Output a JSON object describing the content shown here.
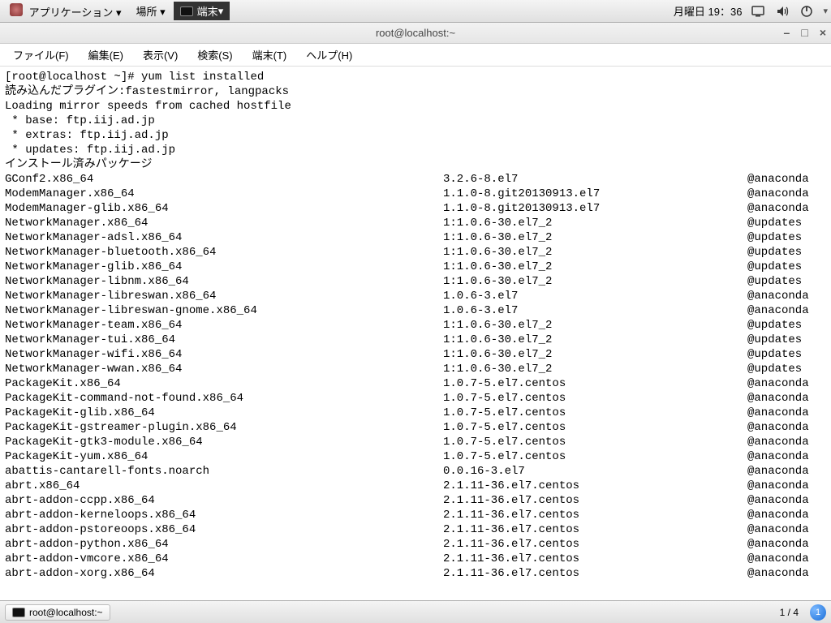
{
  "top_panel": {
    "apps": "アプリケーション",
    "places": "場所",
    "active": "端末",
    "date": "月曜日 19：36"
  },
  "window": {
    "title": "root@localhost:~",
    "menu": {
      "file": "ファイル(F)",
      "edit": "編集(E)",
      "view": "表示(V)",
      "search": "検索(S)",
      "terminal": "端末(T)",
      "help": "ヘルプ(H)"
    }
  },
  "term": {
    "prompt": "[root@localhost ~]# yum list installed",
    "plugin": "読み込んだプラグイン:fastestmirror, langpacks",
    "loading": "Loading mirror speeds from cached hostfile",
    "m_base": " * base: ftp.iij.ad.jp",
    "m_extras": " * extras: ftp.iij.ad.jp",
    "m_updates": " * updates: ftp.iij.ad.jp",
    "installed_header": "インストール済みパッケージ"
  },
  "packages": [
    {
      "name": "GConf2.x86_64",
      "ver": "3.2.6-8.el7",
      "repo": "@anaconda"
    },
    {
      "name": "ModemManager.x86_64",
      "ver": "1.1.0-8.git20130913.el7",
      "repo": "@anaconda"
    },
    {
      "name": "ModemManager-glib.x86_64",
      "ver": "1.1.0-8.git20130913.el7",
      "repo": "@anaconda"
    },
    {
      "name": "NetworkManager.x86_64",
      "ver": "1:1.0.6-30.el7_2",
      "repo": "@updates"
    },
    {
      "name": "NetworkManager-adsl.x86_64",
      "ver": "1:1.0.6-30.el7_2",
      "repo": "@updates"
    },
    {
      "name": "NetworkManager-bluetooth.x86_64",
      "ver": "1:1.0.6-30.el7_2",
      "repo": "@updates"
    },
    {
      "name": "NetworkManager-glib.x86_64",
      "ver": "1:1.0.6-30.el7_2",
      "repo": "@updates"
    },
    {
      "name": "NetworkManager-libnm.x86_64",
      "ver": "1:1.0.6-30.el7_2",
      "repo": "@updates"
    },
    {
      "name": "NetworkManager-libreswan.x86_64",
      "ver": "1.0.6-3.el7",
      "repo": "@anaconda"
    },
    {
      "name": "NetworkManager-libreswan-gnome.x86_64",
      "ver": "1.0.6-3.el7",
      "repo": "@anaconda"
    },
    {
      "name": "NetworkManager-team.x86_64",
      "ver": "1:1.0.6-30.el7_2",
      "repo": "@updates"
    },
    {
      "name": "NetworkManager-tui.x86_64",
      "ver": "1:1.0.6-30.el7_2",
      "repo": "@updates"
    },
    {
      "name": "NetworkManager-wifi.x86_64",
      "ver": "1:1.0.6-30.el7_2",
      "repo": "@updates"
    },
    {
      "name": "NetworkManager-wwan.x86_64",
      "ver": "1:1.0.6-30.el7_2",
      "repo": "@updates"
    },
    {
      "name": "PackageKit.x86_64",
      "ver": "1.0.7-5.el7.centos",
      "repo": "@anaconda"
    },
    {
      "name": "PackageKit-command-not-found.x86_64",
      "ver": "1.0.7-5.el7.centos",
      "repo": "@anaconda"
    },
    {
      "name": "PackageKit-glib.x86_64",
      "ver": "1.0.7-5.el7.centos",
      "repo": "@anaconda"
    },
    {
      "name": "PackageKit-gstreamer-plugin.x86_64",
      "ver": "1.0.7-5.el7.centos",
      "repo": "@anaconda"
    },
    {
      "name": "PackageKit-gtk3-module.x86_64",
      "ver": "1.0.7-5.el7.centos",
      "repo": "@anaconda"
    },
    {
      "name": "PackageKit-yum.x86_64",
      "ver": "1.0.7-5.el7.centos",
      "repo": "@anaconda"
    },
    {
      "name": "abattis-cantarell-fonts.noarch",
      "ver": "0.0.16-3.el7",
      "repo": "@anaconda"
    },
    {
      "name": "abrt.x86_64",
      "ver": "2.1.11-36.el7.centos",
      "repo": "@anaconda"
    },
    {
      "name": "abrt-addon-ccpp.x86_64",
      "ver": "2.1.11-36.el7.centos",
      "repo": "@anaconda"
    },
    {
      "name": "abrt-addon-kerneloops.x86_64",
      "ver": "2.1.11-36.el7.centos",
      "repo": "@anaconda"
    },
    {
      "name": "abrt-addon-pstoreoops.x86_64",
      "ver": "2.1.11-36.el7.centos",
      "repo": "@anaconda"
    },
    {
      "name": "abrt-addon-python.x86_64",
      "ver": "2.1.11-36.el7.centos",
      "repo": "@anaconda"
    },
    {
      "name": "abrt-addon-vmcore.x86_64",
      "ver": "2.1.11-36.el7.centos",
      "repo": "@anaconda"
    },
    {
      "name": "abrt-addon-xorg.x86_64",
      "ver": "2.1.11-36.el7.centos",
      "repo": "@anaconda"
    }
  ],
  "bottom": {
    "task_label": "root@localhost:~",
    "workspace": "1 / 4",
    "notif": "1"
  }
}
